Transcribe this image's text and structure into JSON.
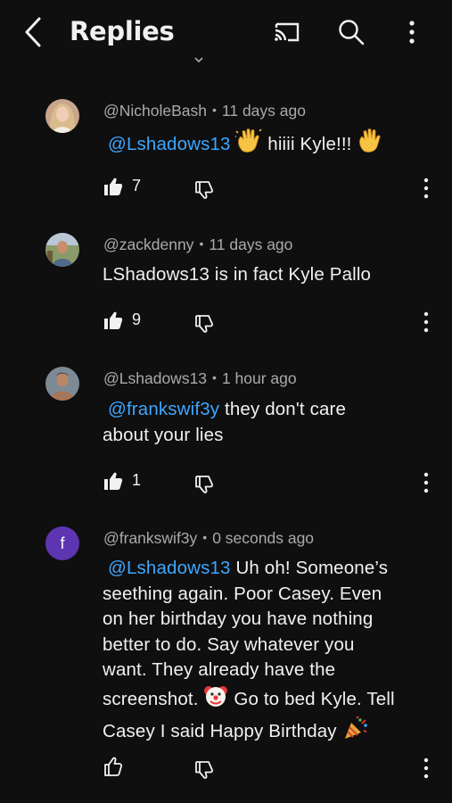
{
  "header": {
    "title": "Replies",
    "icons": [
      "back-arrow-icon",
      "cast-icon",
      "search-icon",
      "more-vertical-icon"
    ]
  },
  "comments": [
    {
      "author": "@NicholeBash",
      "time": "11 days ago",
      "mention": "@Lshadows13",
      "text": "hiiii Kyle!!!",
      "likes": "7",
      "liked": true,
      "avatar": "photo"
    },
    {
      "author": "@zackdenny",
      "time": "11 days ago",
      "text": "LShadows13 is in fact Kyle Pallo",
      "likes": "9",
      "liked": true,
      "avatar": "photo"
    },
    {
      "author": "@Lshadows13",
      "time": "1 hour ago",
      "mention": "@frankswif3y",
      "text_line1": "they don't care",
      "text_line2": "about your lies",
      "likes": "1",
      "liked": true,
      "avatar": "photo"
    },
    {
      "author": "@frankswif3y",
      "time": "0 seconds ago",
      "avatar_letter": "f",
      "avatar_color": "#5e35b1",
      "mention": "@Lshadows13",
      "line1": "Uh oh! Someone’s",
      "line2": "seething again. Poor Casey. Even",
      "line3": "on her birthday you have nothing",
      "line4": "better to do. Say whatever you",
      "line5": "want. They already have the",
      "line6a": "screenshot.",
      "line6b": "Go to bed Kyle. Tell",
      "line7": "Casey I said Happy Birthday",
      "likes": "",
      "liked": false
    }
  ],
  "colors": {
    "background": "#0f0f0f",
    "text": "#f1f1f1",
    "meta": "#aaaaaa",
    "mention": "#3ea6ff"
  }
}
